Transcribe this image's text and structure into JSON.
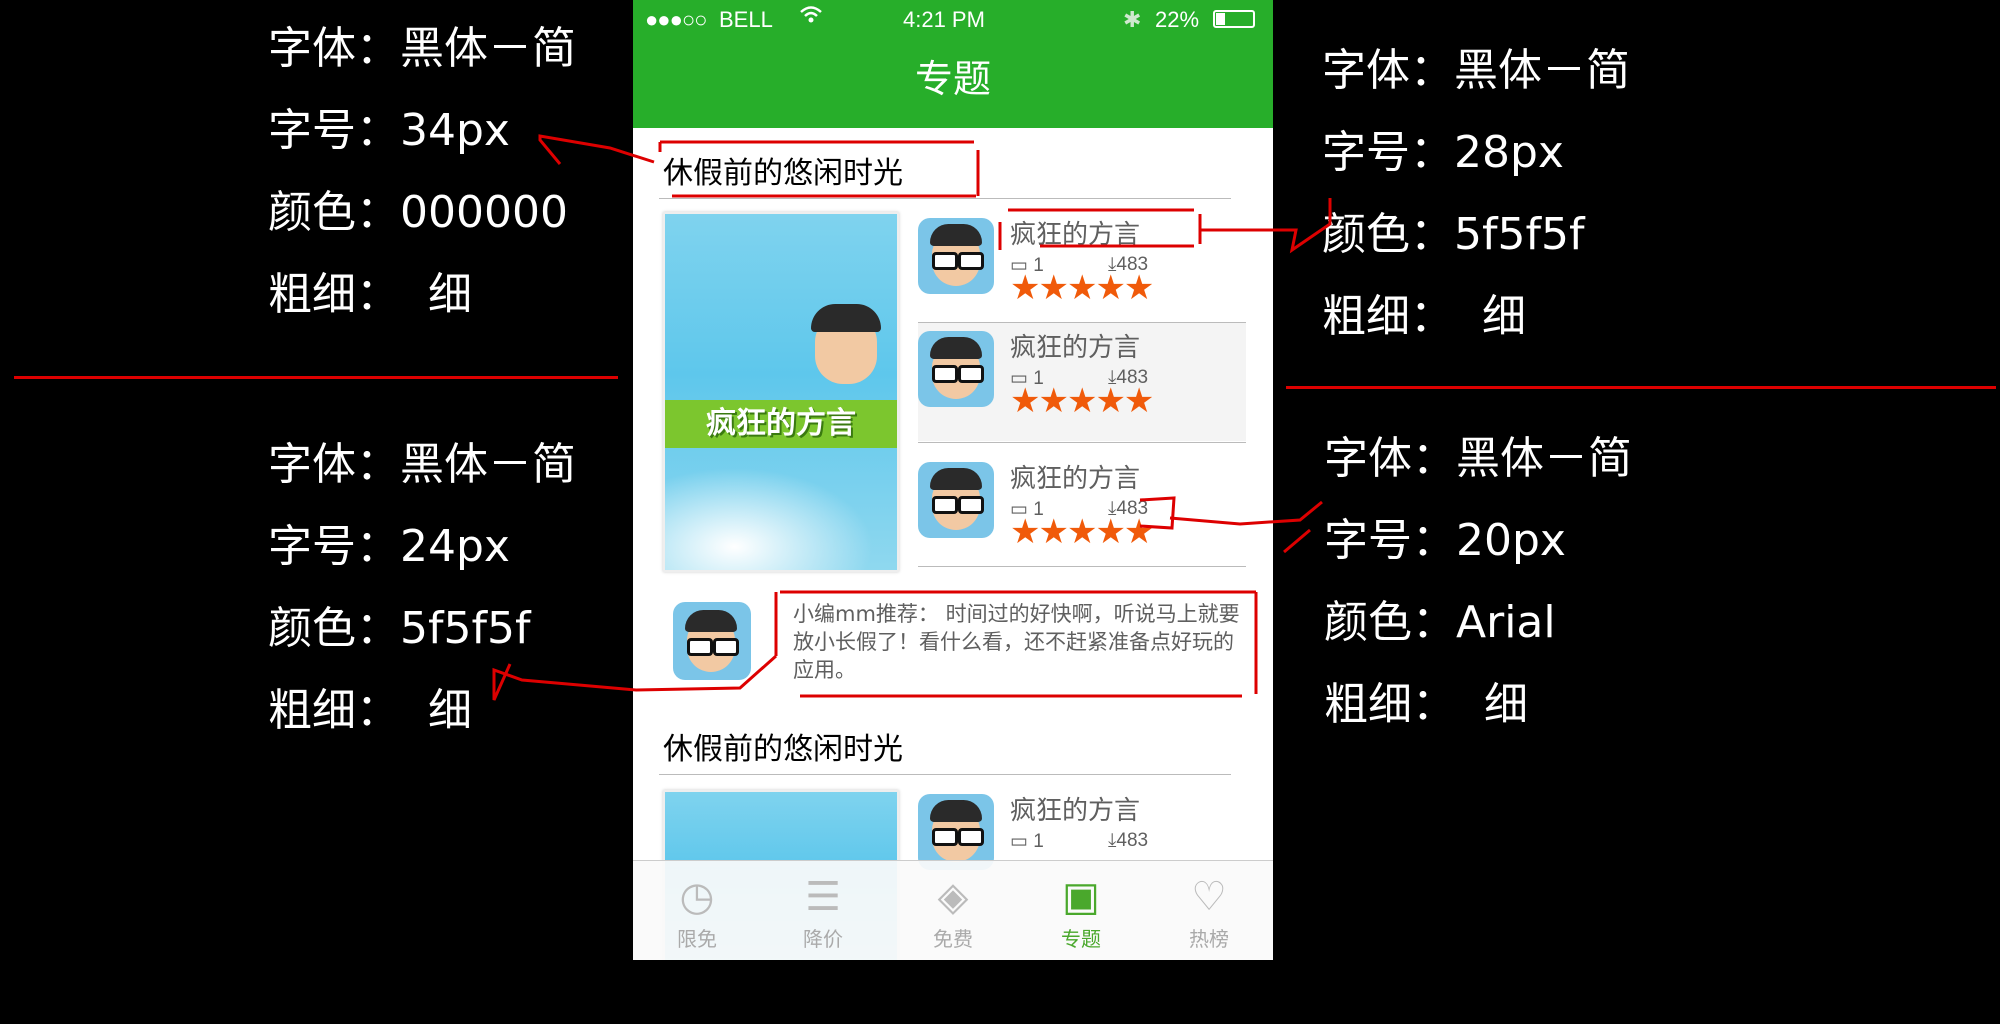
{
  "annotations": {
    "title_spec": {
      "font_label": "字体：",
      "font": "黑体－简",
      "size_label": "字号：",
      "size": "34px",
      "color_label": "颜色：",
      "color": "000000",
      "weight_label": "粗细：",
      "weight": "细"
    },
    "desc_spec": {
      "font_label": "字体：",
      "font": "黑体－简",
      "size_label": "字号：",
      "size": "24px",
      "color_label": "颜色：",
      "color": "5f5f5f",
      "weight_label": "粗细：",
      "weight": "细"
    },
    "name_spec": {
      "font_label": "字体：",
      "font": "黑体－简",
      "size_label": "字号：",
      "size": "28px",
      "color_label": "颜色：",
      "color": "5f5f5f",
      "weight_label": "粗细：",
      "weight": "细"
    },
    "meta_spec": {
      "font_label": "字体：",
      "font": "黑体－简",
      "size_label": "字号：",
      "size": "20px",
      "color_label": "颜色：",
      "color": "Arial",
      "weight_label": "粗细：",
      "weight": "细"
    }
  },
  "status_bar": {
    "signal": "●●●○○",
    "carrier": "BELL",
    "time": "4:21 PM",
    "bluetooth": "✱",
    "battery": "22%"
  },
  "nav": {
    "title": "专题"
  },
  "section1": {
    "title": "休假前的悠闲时光",
    "feature_banner": "疯狂的方言",
    "apps": [
      {
        "name": "疯狂的方言",
        "count": "1",
        "downloads": "483",
        "stars": "★★★★★"
      },
      {
        "name": "疯狂的方言",
        "count": "1",
        "downloads": "483",
        "stars": "★★★★★"
      },
      {
        "name": "疯狂的方言",
        "count": "1",
        "downloads": "483",
        "stars": "★★★★★"
      }
    ],
    "recommendation": "小编mm推荐：  时间过的好快啊，听说马上就要放小长假了！看什么看，还不赶紧准备点好玩的应用。"
  },
  "section2": {
    "title": "休假前的悠闲时光",
    "apps": [
      {
        "name": "疯狂的方言",
        "count": "1",
        "downloads": "483"
      }
    ]
  },
  "tabs": [
    {
      "label": "限免",
      "icon": "clock-icon"
    },
    {
      "label": "降价",
      "icon": "coins-icon"
    },
    {
      "label": "免费",
      "icon": "price-tag-icon"
    },
    {
      "label": "专题",
      "icon": "picture-icon",
      "active": true
    },
    {
      "label": "热榜",
      "icon": "lightbulb-icon"
    }
  ],
  "colors": {
    "accent": "#27ae2a",
    "text_primary": "#000000",
    "text_secondary": "#5f5f5f",
    "star": "#f05a0a",
    "annotation_line": "#dd0000"
  }
}
